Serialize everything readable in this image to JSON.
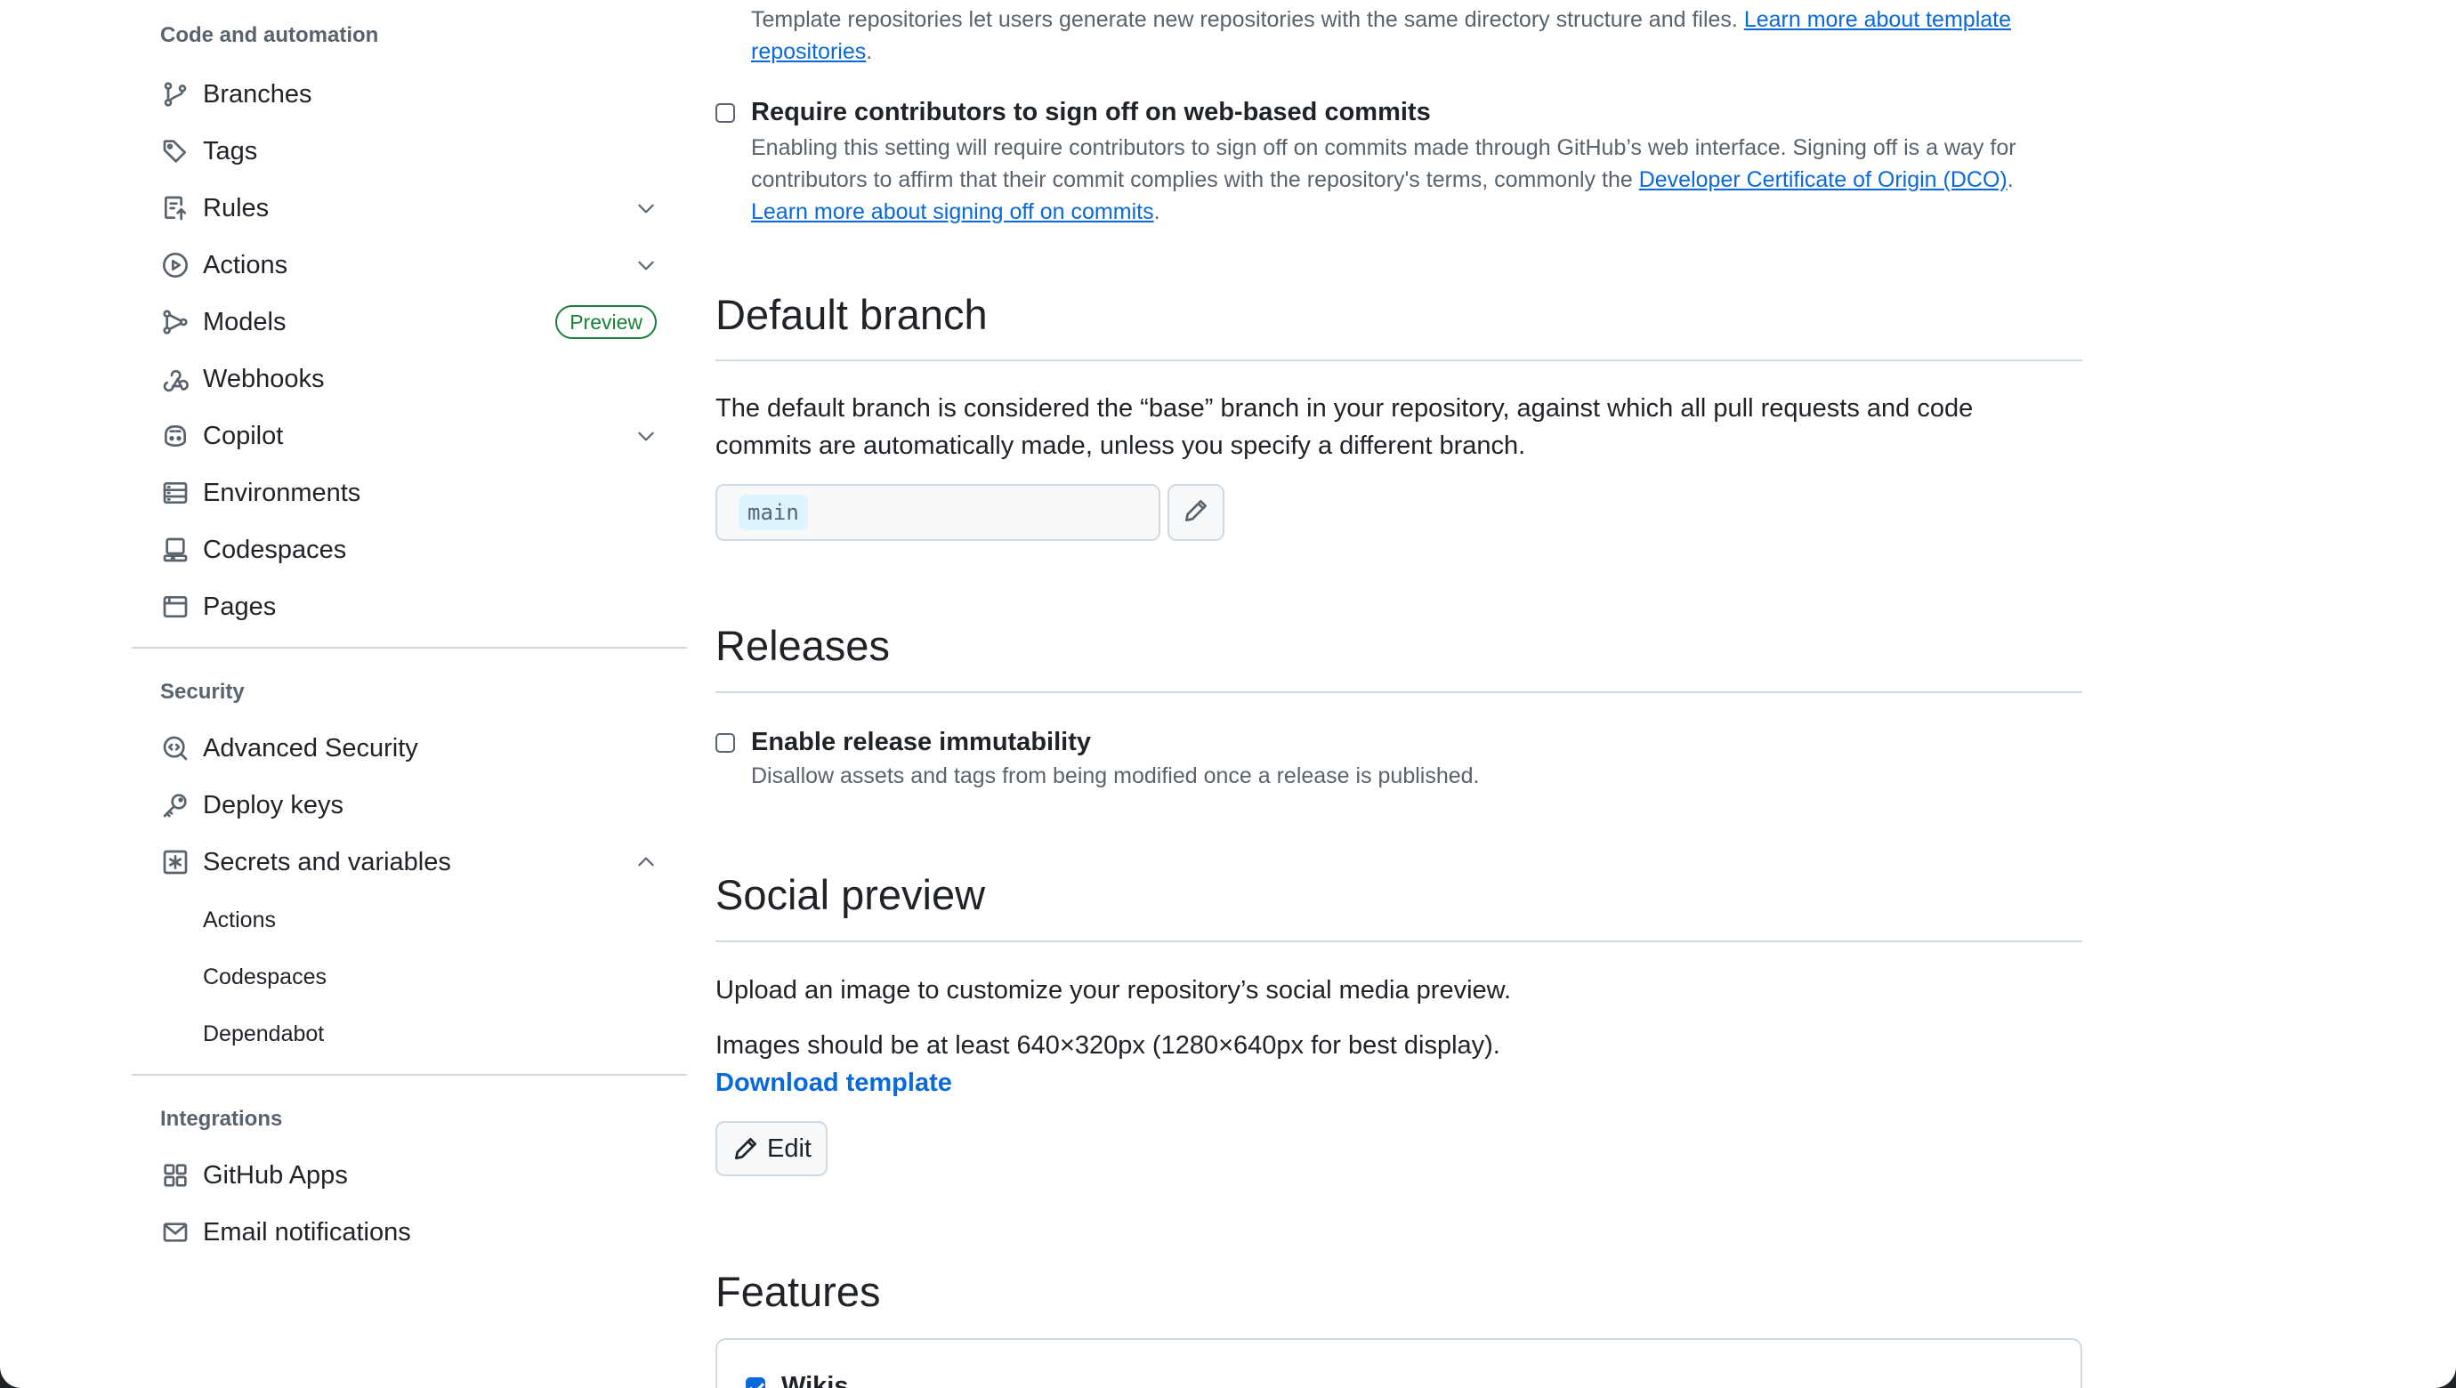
{
  "sidebar": {
    "code_section_title": "Code and automation",
    "code_items": [
      {
        "label": "Branches",
        "icon": "git-branch-icon"
      },
      {
        "label": "Tags",
        "icon": "tag-icon"
      },
      {
        "label": "Rules",
        "icon": "rules-icon"
      },
      {
        "label": "Actions",
        "icon": "play-icon"
      },
      {
        "label": "Models",
        "icon": "models-icon",
        "badge": "Preview"
      },
      {
        "label": "Webhooks",
        "icon": "webhook-icon"
      },
      {
        "label": "Copilot",
        "icon": "copilot-icon"
      },
      {
        "label": "Environments",
        "icon": "server-icon"
      },
      {
        "label": "Codespaces",
        "icon": "codespaces-icon"
      },
      {
        "label": "Pages",
        "icon": "browser-icon"
      }
    ],
    "security_section_title": "Security",
    "security_items": [
      {
        "label": "Advanced Security",
        "icon": "codescan-icon"
      },
      {
        "label": "Deploy keys",
        "icon": "key-icon"
      },
      {
        "label": "Secrets and variables",
        "icon": "asterisk-icon"
      }
    ],
    "secrets_subitems": [
      "Actions",
      "Codespaces",
      "Dependabot"
    ],
    "integrations_section_title": "Integrations",
    "integrations_items": [
      {
        "label": "GitHub Apps",
        "icon": "apps-icon"
      },
      {
        "label": "Email notifications",
        "icon": "mail-icon"
      }
    ]
  },
  "main": {
    "template_desc": "Template repositories let users generate new repositories with the same directory structure and files.",
    "template_link": "Learn more about template repositories",
    "signoff": {
      "label": "Require contributors to sign off on web-based commits",
      "checked": false,
      "desc_1": "Enabling this setting will require contributors to sign off on commits made through GitHub’s web interface. Signing off is a way for contributors to affirm that their commit complies with the repository's terms, commonly the",
      "dco_link": "Developer Certificate of Origin (DCO)",
      "learn_link": "Learn more about signing off on commits"
    },
    "default_branch": {
      "heading": "Default branch",
      "description": "The default branch is considered the “base” branch in your repository, against which all pull requests and code commits are automatically made, unless you specify a different branch.",
      "branch_name": "main"
    },
    "releases": {
      "heading": "Releases",
      "immutability_label": "Enable release immutability",
      "immutability_checked": false,
      "immutability_desc": "Disallow assets and tags from being modified once a release is published."
    },
    "social_preview": {
      "heading": "Social preview",
      "line1": "Upload an image to customize your repository’s social media preview.",
      "line2": "Images should be at least 640×320px (1280×640px for best display).",
      "download_link": "Download template",
      "edit_label": "Edit"
    },
    "features": {
      "heading": "Features",
      "wikis_label": "Wikis",
      "wikis_checked": true
    }
  },
  "colors": {
    "accent": "#0969da",
    "preview_badge": "#1a7f37",
    "muted": "#59636e",
    "border": "#d1d9e0"
  }
}
